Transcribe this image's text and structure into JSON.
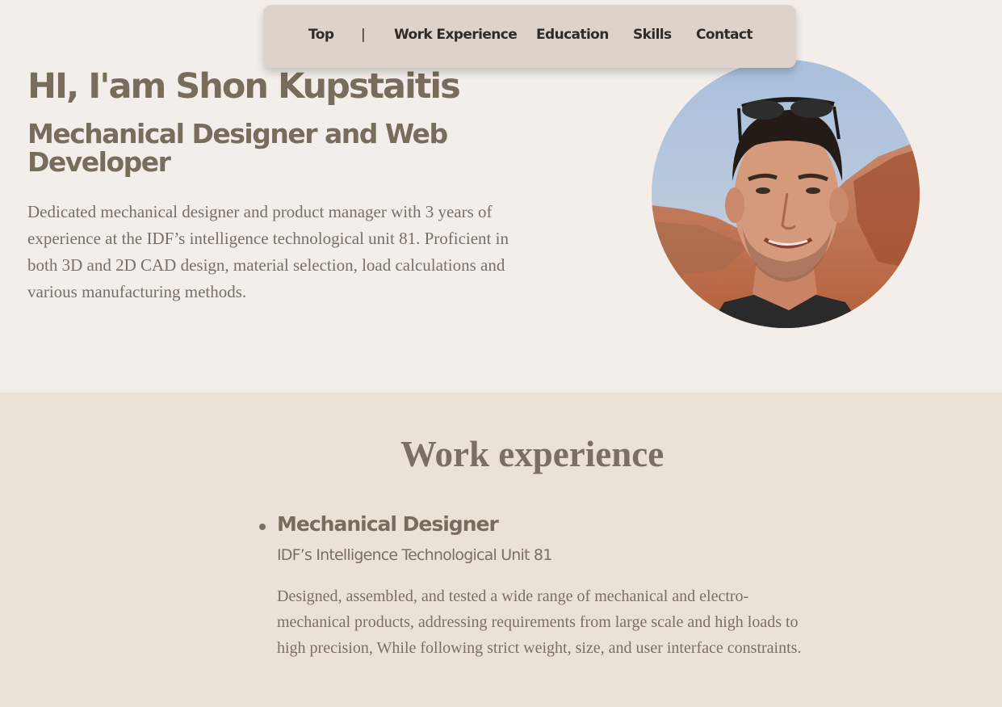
{
  "nav": {
    "items": [
      {
        "label": "Top"
      },
      {
        "label": "|"
      },
      {
        "label": "Work Experience"
      },
      {
        "label": "Education"
      },
      {
        "label": "Skills"
      },
      {
        "label": "Contact"
      }
    ]
  },
  "hero": {
    "title": "HI, I'am Shon Kupstaitis",
    "subtitle": "Mechanical Designer and Web Developer",
    "description": "Dedicated mechanical designer and product manager with 3 years of experience at the IDF’s intelligence technological unit 81. Proficient in both 3D and 2D CAD design, material selection, load calculations and various manufacturing methods.",
    "photo": "profile-photo"
  },
  "work": {
    "heading": "Work experience",
    "jobs": [
      {
        "title": "Mechanical Designer",
        "organization": "IDF’s Intelligence Technological Unit 81",
        "description": "Designed, assembled, and tested a wide range of mechanical and electro-mechanical products, addressing requirements from large scale and high loads to high precision, While following strict weight, size, and user interface constraints."
      }
    ]
  },
  "colors": {
    "page_bg": "#f3eee9",
    "section_bg": "#ebe2d7",
    "nav_bg": "#ddd3ca",
    "heading_text": "#786c5d",
    "body_text": "#7a6f66"
  }
}
